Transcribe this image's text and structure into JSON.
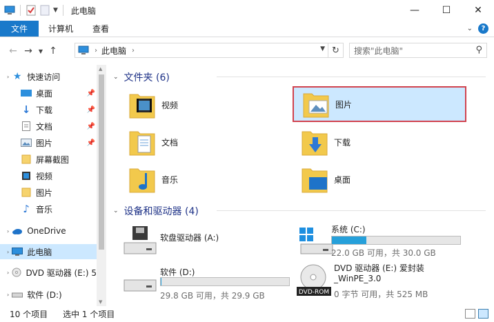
{
  "window": {
    "title": "此电脑"
  },
  "ribbon": {
    "tabs": [
      "文件",
      "计算机",
      "查看"
    ]
  },
  "address": {
    "crumb": "此电脑",
    "search_placeholder": "搜索\"此电脑\""
  },
  "sidebar": {
    "items": [
      {
        "label": "快速访问",
        "icon": "star-icon",
        "pinned": false
      },
      {
        "label": "桌面",
        "icon": "desktop-icon",
        "pinned": true
      },
      {
        "label": "下载",
        "icon": "download-icon",
        "pinned": true
      },
      {
        "label": "文档",
        "icon": "document-icon",
        "pinned": true
      },
      {
        "label": "图片",
        "icon": "picture-icon",
        "pinned": true
      },
      {
        "label": "屏幕截图",
        "icon": "folder-icon",
        "pinned": false
      },
      {
        "label": "视频",
        "icon": "video-icon",
        "pinned": false
      },
      {
        "label": "图片",
        "icon": "folder-icon",
        "pinned": false
      },
      {
        "label": "音乐",
        "icon": "music-icon",
        "pinned": false
      },
      {
        "label": "OneDrive",
        "icon": "cloud-icon",
        "pinned": false
      },
      {
        "label": "此电脑",
        "icon": "computer-icon",
        "pinned": false,
        "selected": true
      },
      {
        "label": "DVD 驱动器 (E:) 5",
        "icon": "dvd-icon",
        "pinned": false
      },
      {
        "label": "软件 (D:)",
        "icon": "drive-icon",
        "pinned": false
      }
    ]
  },
  "folders": {
    "header": "文件夹 (6)",
    "items": [
      {
        "label": "视频",
        "icon": "video-folder-icon"
      },
      {
        "label": "图片",
        "icon": "picture-folder-icon",
        "selected": true
      },
      {
        "label": "文档",
        "icon": "document-folder-icon"
      },
      {
        "label": "下载",
        "icon": "download-folder-icon"
      },
      {
        "label": "音乐",
        "icon": "music-folder-icon"
      },
      {
        "label": "桌面",
        "icon": "desktop-folder-icon"
      }
    ]
  },
  "drives": {
    "header": "设备和驱动器 (4)",
    "items": [
      {
        "label": "软盘驱动器 (A:)",
        "info": "",
        "used_fraction": null,
        "icon": "floppy-drive-icon"
      },
      {
        "label": "系统 (C:)",
        "info": "22.0 GB 可用，共 30.0 GB",
        "used_fraction": 0.27,
        "icon": "system-drive-icon"
      },
      {
        "label": "软件 (D:)",
        "info": "29.8 GB 可用，共 29.9 GB",
        "used_fraction": 0.003,
        "icon": "drive-icon"
      },
      {
        "label": "DVD 驱动器 (E:) 爱封装_WinPE_3.0",
        "info": "0 字节 可用，共 525 MB",
        "used_fraction": null,
        "icon": "dvd-rom-icon"
      }
    ]
  },
  "status": {
    "count": "10 个项目",
    "selected": "选中 1 个项目"
  },
  "colors": {
    "accent": "#1979ca",
    "selection": "#cce8ff",
    "highlight_border": "#d1424e",
    "header_text": "#1e3287",
    "bar_fill": "#26a0da"
  }
}
